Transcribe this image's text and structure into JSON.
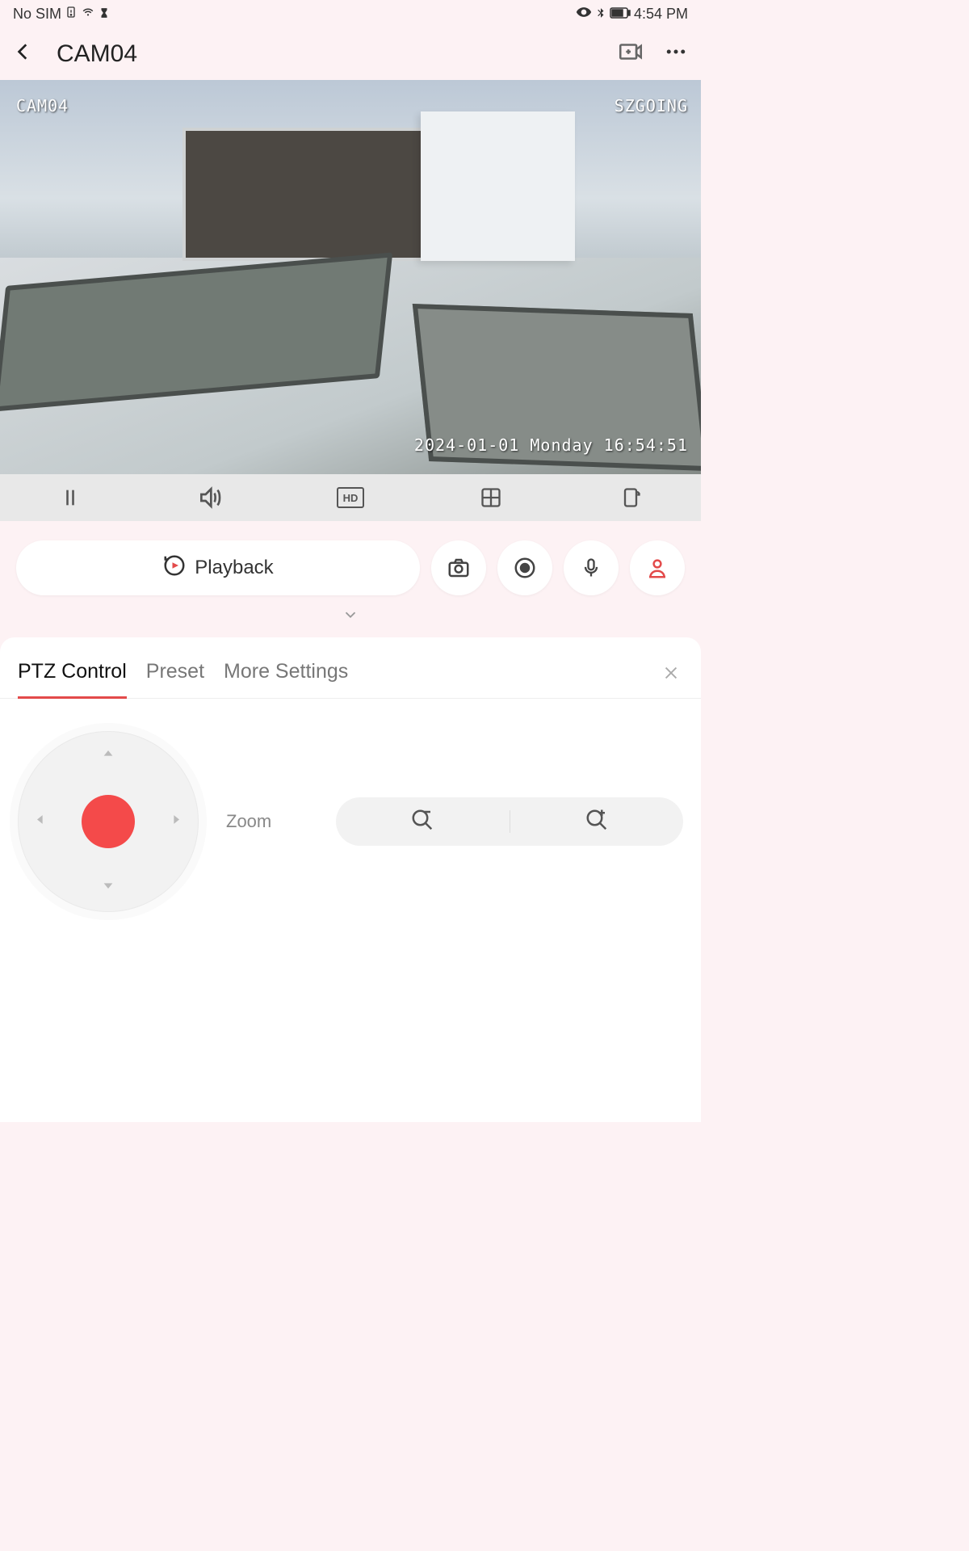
{
  "status_bar": {
    "sim_text": "No SIM",
    "time": "4:54 PM"
  },
  "app_bar": {
    "title": "CAM04"
  },
  "video_osd": {
    "cam_label": "CAM04",
    "brand": "SZGOING",
    "timestamp": "2024-01-01 Monday 16:54:51"
  },
  "video_toolbar": {
    "quality_label": "HD"
  },
  "actions": {
    "playback_label": "Playback"
  },
  "ptz_panel": {
    "tabs": {
      "ptz": "PTZ Control",
      "preset": "Preset",
      "more": "More Settings"
    },
    "zoom_label": "Zoom"
  },
  "colors": {
    "accent": "#e34a4a"
  }
}
